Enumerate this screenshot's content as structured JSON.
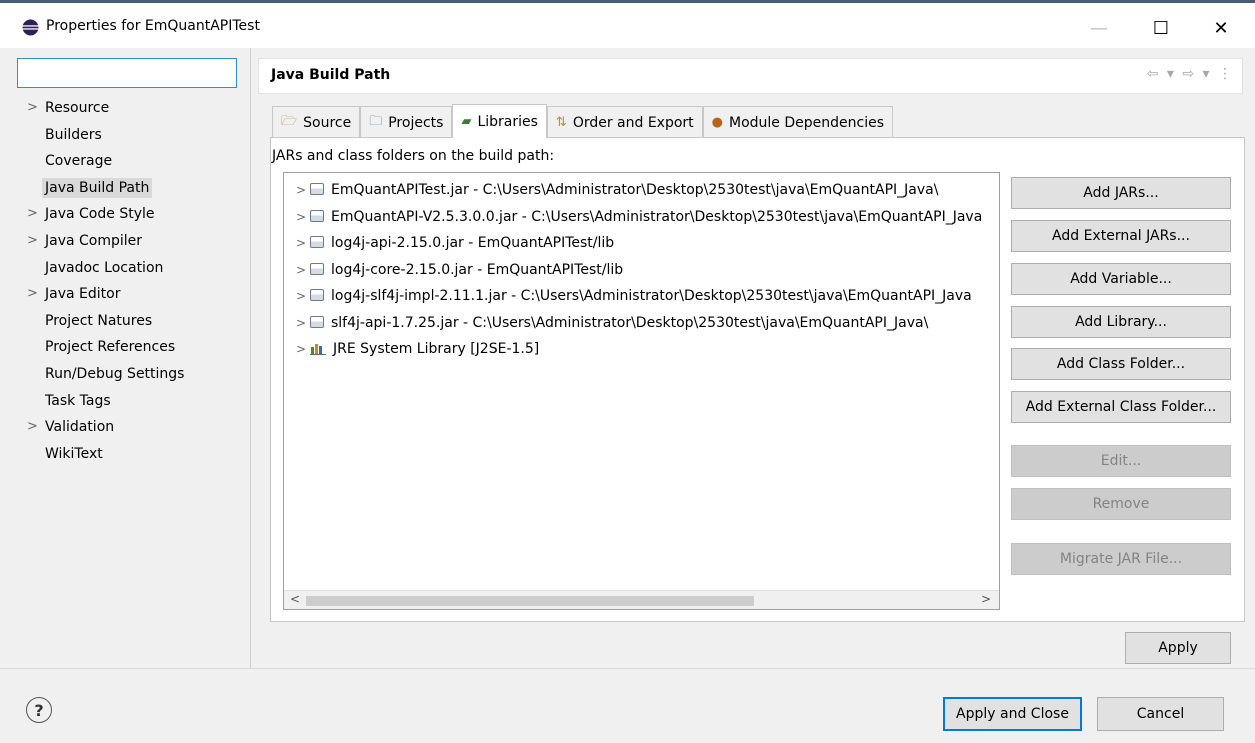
{
  "window": {
    "title": "Properties for EmQuantAPITest",
    "minimize": "—",
    "maximize": "☐",
    "close": "✕"
  },
  "nav": {
    "filter_value": "",
    "items": [
      {
        "label": "Resource",
        "expandable": true
      },
      {
        "label": "Builders",
        "expandable": false
      },
      {
        "label": "Coverage",
        "expandable": false
      },
      {
        "label": "Java Build Path",
        "expandable": false,
        "selected": true
      },
      {
        "label": "Java Code Style",
        "expandable": true
      },
      {
        "label": "Java Compiler",
        "expandable": true
      },
      {
        "label": "Javadoc Location",
        "expandable": false
      },
      {
        "label": "Java Editor",
        "expandable": true
      },
      {
        "label": "Project Natures",
        "expandable": false
      },
      {
        "label": "Project References",
        "expandable": false
      },
      {
        "label": "Run/Debug Settings",
        "expandable": false
      },
      {
        "label": "Task Tags",
        "expandable": false
      },
      {
        "label": "Validation",
        "expandable": true
      },
      {
        "label": "WikiText",
        "expandable": false
      }
    ]
  },
  "page": {
    "title": "Java Build Path",
    "nav_arrows": "⇦ ▾ ⇨ ▾ ⋮"
  },
  "tabs": [
    {
      "label": "Source",
      "icon": "source-folder-icon",
      "glyph": "🗁",
      "active": false
    },
    {
      "label": "Projects",
      "icon": "projects-icon",
      "glyph": "🗀",
      "active": false
    },
    {
      "label": "Libraries",
      "icon": "libraries-icon",
      "glyph": "▰",
      "active": true
    },
    {
      "label": "Order and Export",
      "icon": "order-export-icon",
      "glyph": "⇅",
      "active": false
    },
    {
      "label": "Module Dependencies",
      "icon": "module-icon",
      "glyph": "●",
      "active": false
    }
  ],
  "libraries": {
    "label": "JARs and class folders on the build path:",
    "items": [
      {
        "text": "EmQuantAPITest.jar - C:\\Users\\Administrator\\Desktop\\2530test\\java\\EmQuantAPI_Java\\",
        "icon": "jar-icon"
      },
      {
        "text": "EmQuantAPI-V2.5.3.0.0.jar - C:\\Users\\Administrator\\Desktop\\2530test\\java\\EmQuantAPI_Java",
        "icon": "jar-icon"
      },
      {
        "text": "log4j-api-2.15.0.jar - EmQuantAPITest/lib",
        "icon": "jar-icon"
      },
      {
        "text": "log4j-core-2.15.0.jar - EmQuantAPITest/lib",
        "icon": "jar-icon"
      },
      {
        "text": "log4j-slf4j-impl-2.11.1.jar - C:\\Users\\Administrator\\Desktop\\2530test\\java\\EmQuantAPI_Java",
        "icon": "jar-icon"
      },
      {
        "text": "slf4j-api-1.7.25.jar - C:\\Users\\Administrator\\Desktop\\2530test\\java\\EmQuantAPI_Java\\",
        "icon": "jar-icon"
      },
      {
        "text": "JRE System Library [J2SE-1.5]",
        "icon": "jre-library-icon"
      }
    ]
  },
  "buttons": {
    "add_jars": "Add JARs...",
    "add_external_jars": "Add External JARs...",
    "add_variable": "Add Variable...",
    "add_library": "Add Library...",
    "add_class_folder": "Add Class Folder...",
    "add_external_class_folder": "Add External Class Folder...",
    "edit": "Edit...",
    "remove": "Remove",
    "migrate_jar": "Migrate JAR File...",
    "apply": "Apply",
    "apply_and_close": "Apply and Close",
    "cancel": "Cancel"
  },
  "footer": {
    "help_glyph": "?"
  }
}
